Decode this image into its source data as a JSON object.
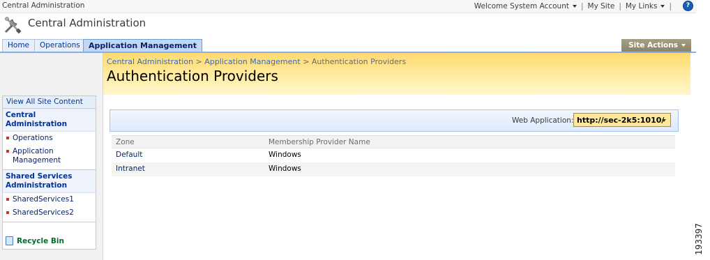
{
  "topbar": {
    "site_name": "Central Administration",
    "welcome": "Welcome System Account",
    "my_site": "My Site",
    "my_links": "My Links",
    "sep": "|",
    "help": "?"
  },
  "header": {
    "title": "Central Administration"
  },
  "tabs": [
    {
      "label": "Home"
    },
    {
      "label": "Operations"
    },
    {
      "label": "Application Management"
    }
  ],
  "site_actions": "Site Actions",
  "leftnav": {
    "view_all": "View All Site Content",
    "groups": [
      {
        "title": "Central Administration",
        "items": [
          "Operations",
          "Application Management"
        ]
      },
      {
        "title": "Shared Services Administration",
        "items": [
          "SharedServices1",
          "SharedServices2"
        ]
      }
    ],
    "recycle_bin": "Recycle Bin"
  },
  "breadcrumb": {
    "items": [
      "Central Administration",
      "Application Management",
      "Authentication Providers"
    ],
    "sep": ">"
  },
  "page_title": "Authentication Providers",
  "web_application": {
    "label": "Web Application:",
    "value": "http://sec-2k5:1010/"
  },
  "table": {
    "headers": [
      "Zone",
      "Membership Provider Name"
    ],
    "rows": [
      {
        "zone": "Default",
        "provider": "Windows"
      },
      {
        "zone": "Intranet",
        "provider": "Windows"
      }
    ]
  },
  "figure_id": "193397"
}
